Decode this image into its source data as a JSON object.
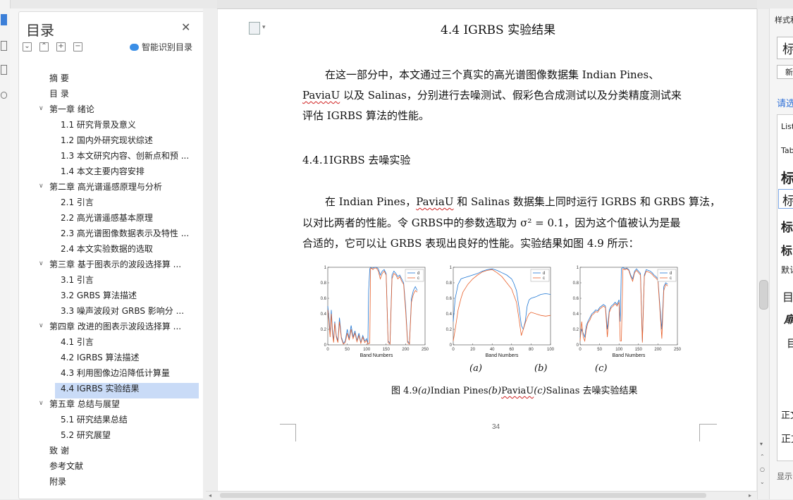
{
  "toc": {
    "title": "目录",
    "smart_label": "智能识别目录",
    "items": [
      {
        "label": "摘 要",
        "level": 0
      },
      {
        "label": "目 录",
        "level": 0
      },
      {
        "label": "第一章 绪论",
        "level": 0,
        "expanded": true
      },
      {
        "label": "1.1 研究背景及意义",
        "level": 1
      },
      {
        "label": "1.2 国内外研究现状综述",
        "level": 1
      },
      {
        "label": "1.3 本文研究内容、创新点和预 ...",
        "level": 1
      },
      {
        "label": "1.4 本文主要内容安排",
        "level": 1
      },
      {
        "label": "第二章 高光谱遥感原理与分析",
        "level": 0,
        "expanded": true
      },
      {
        "label": "2.1 引言",
        "level": 1
      },
      {
        "label": "2.2 高光谱遥感基本原理",
        "level": 1
      },
      {
        "label": "2.3 高光谱图像数据表示及特性 ...",
        "level": 1
      },
      {
        "label": "2.4 本文实验数据的选取",
        "level": 1
      },
      {
        "label": "第三章 基于图表示的波段选择算 ...",
        "level": 0,
        "expanded": true
      },
      {
        "label": "3.1 引言",
        "level": 1
      },
      {
        "label": "3.2 GRBS 算法描述",
        "level": 1
      },
      {
        "label": "3.3 噪声波段对 GRBS 影响分 ...",
        "level": 1
      },
      {
        "label": "第四章 改进的图表示波段选择算 ...",
        "level": 0,
        "expanded": true
      },
      {
        "label": "4.1 引言",
        "level": 1
      },
      {
        "label": "4.2 IGRBS 算法描述",
        "level": 1
      },
      {
        "label": "4.3 利用图像边沿降低计算量",
        "level": 1
      },
      {
        "label": "4.4 IGRBS 实验结果",
        "level": 1,
        "selected": true
      },
      {
        "label": "第五章 总结与展望",
        "level": 0,
        "expanded": true
      },
      {
        "label": "5.1 研究结果总结",
        "level": 1
      },
      {
        "label": "5.2 研究展望",
        "level": 1
      },
      {
        "label": "致 谢",
        "level": 0
      },
      {
        "label": "参考文献",
        "level": 0
      },
      {
        "label": "附录",
        "level": 0
      }
    ]
  },
  "doc": {
    "heading": "4.4 IGRBS 实验结果",
    "p1_l1": "在这一部分中，本文通过三个真实的高光谱图像数据集 Indian Pines、",
    "p1_l2a": "PaviaU",
    "p1_l2b": " 以及 Salinas，分别进行去噪测试、假彩色合成测试以及分类精度测试来",
    "p1_l3": "评估 IGRBS 算法的性能。",
    "subheading": "4.4.1IGRBS 去噪实验",
    "p2_l1a": "在 Indian Pines，",
    "p2_l1b": "PaviaU",
    "p2_l1c": " 和 Salinas 数据集上同时运行 IGRBS 和 GRBS 算法，",
    "p2_l2": "以对比两者的性能。令 GRBS中的参数选取为 σ² = 0.1，因为这个值被认为是最",
    "p2_l3": "合适的，它可以让 GRBS 表现出良好的性能。实验结果如图 4.9 所示：",
    "panel_a": "(a)",
    "panel_b": "(b)",
    "panel_c": "(c)",
    "caption_a": "图 4.9",
    "caption_b": "(a)",
    "caption_c": "Indian Pines",
    "caption_d": "(b)",
    "caption_e": "PaviaU",
    "caption_f": "(c)",
    "caption_g": "Salinas 去噪实验结果",
    "page_number": "34"
  },
  "right_pane": {
    "items": [
      "样式和",
      "标",
      "新",
      "请选",
      "List",
      "Tab",
      "标",
      "标",
      "标",
      "标",
      "默认",
      "目",
      "扉",
      "目",
      "正文",
      "正文",
      "显示"
    ]
  },
  "chart_data": [
    {
      "type": "line",
      "xlabel": "Band Numbers",
      "xlim": [
        0,
        250
      ],
      "ylim": [
        0,
        1
      ],
      "xticks": [
        0,
        50,
        100,
        150,
        200,
        250
      ],
      "yticks": [
        0,
        0.2,
        0.4,
        0.6,
        0.8,
        1
      ],
      "legend": "top-right",
      "series": [
        {
          "name": "d",
          "color": "#1f77d4",
          "x": [
            0,
            3,
            6,
            9,
            12,
            15,
            18,
            22,
            26,
            30,
            35,
            40,
            45,
            50,
            55,
            60,
            65,
            70,
            75,
            80,
            85,
            90,
            95,
            100,
            103,
            105,
            108,
            110,
            112,
            116,
            120,
            125,
            130,
            135,
            140,
            145,
            150,
            155,
            160,
            165,
            170,
            175,
            180,
            185,
            190,
            195,
            200,
            205,
            210,
            215,
            220,
            225,
            230
          ],
          "y": [
            0.5,
            0.35,
            0.15,
            0.45,
            0.2,
            0.05,
            0.3,
            0.12,
            0.05,
            0.35,
            0.1,
            0.02,
            0.05,
            0.2,
            0.08,
            0.25,
            0.1,
            0.18,
            0.05,
            0.15,
            0.03,
            0.12,
            0.05,
            0.08,
            0.02,
            0.7,
            0.98,
            1,
            0.99,
            0.99,
            1,
            1,
            0.98,
            0.9,
            0.95,
            0.97,
            0.92,
            0.05,
            0.02,
            0.9,
            0.95,
            0.92,
            0.88,
            0.9,
            0.85,
            0.8,
            0.5,
            0.05,
            0.02,
            0.6,
            0.7,
            0.75,
            0.7
          ]
        },
        {
          "name": "c",
          "color": "#e8612c",
          "x": [
            0,
            3,
            6,
            9,
            12,
            15,
            18,
            22,
            26,
            30,
            35,
            40,
            45,
            50,
            55,
            60,
            65,
            70,
            75,
            80,
            85,
            90,
            95,
            100,
            103,
            105,
            108,
            110,
            112,
            116,
            120,
            125,
            130,
            135,
            140,
            145,
            150,
            155,
            160,
            165,
            170,
            175,
            180,
            185,
            190,
            195,
            200,
            205,
            210,
            215,
            220,
            225,
            230
          ],
          "y": [
            0.45,
            0.3,
            0.1,
            0.4,
            0.15,
            0.03,
            0.28,
            0.1,
            0.03,
            0.3,
            0.08,
            0.01,
            0.03,
            0.15,
            0.06,
            0.2,
            0.08,
            0.15,
            0.04,
            0.12,
            0.02,
            0.1,
            0.03,
            0.06,
            0.01,
            0.02,
            0.02,
            0.98,
            0.99,
            0.97,
            0.99,
            0.99,
            0.95,
            0.85,
            0.92,
            0.95,
            0.9,
            0.03,
            0.01,
            0.85,
            0.92,
            0.9,
            0.85,
            0.88,
            0.82,
            0.78,
            0.45,
            0.03,
            0.01,
            0.55,
            0.65,
            0.7,
            0.68
          ]
        }
      ]
    },
    {
      "type": "line",
      "xlabel": "Band Numbers",
      "xlim": [
        0,
        100
      ],
      "ylim": [
        0,
        1
      ],
      "xticks": [
        0,
        20,
        40,
        60,
        80,
        100
      ],
      "yticks": [
        0,
        0.2,
        0.4,
        0.6,
        0.8,
        1
      ],
      "legend": "top-right",
      "series": [
        {
          "name": "d",
          "color": "#1f77d4",
          "x": [
            0,
            2,
            5,
            8,
            10,
            15,
            20,
            25,
            30,
            35,
            40,
            45,
            50,
            55,
            60,
            62,
            65,
            68,
            70,
            72,
            74,
            76,
            78,
            80,
            85,
            90,
            95,
            100
          ],
          "y": [
            0.3,
            0.6,
            0.78,
            0.85,
            0.86,
            0.88,
            0.9,
            0.92,
            0.95,
            0.97,
            0.98,
            0.96,
            0.93,
            0.9,
            0.85,
            0.8,
            0.7,
            0.45,
            0.25,
            0.2,
            0.3,
            0.5,
            0.58,
            0.6,
            0.62,
            0.65,
            0.66,
            0.65
          ]
        },
        {
          "name": "c",
          "color": "#e8612c",
          "x": [
            0,
            2,
            5,
            8,
            10,
            15,
            20,
            25,
            30,
            35,
            40,
            45,
            50,
            55,
            60,
            62,
            65,
            68,
            70,
            72,
            74,
            76,
            78,
            80,
            85,
            90,
            95,
            100
          ],
          "y": [
            0.05,
            0.2,
            0.45,
            0.6,
            0.68,
            0.78,
            0.85,
            0.9,
            0.94,
            0.96,
            0.97,
            0.93,
            0.88,
            0.8,
            0.72,
            0.65,
            0.55,
            0.3,
            0.12,
            0.2,
            0.28,
            0.35,
            0.4,
            0.42,
            0.4,
            0.38,
            0.37,
            0.38
          ]
        }
      ]
    },
    {
      "type": "line",
      "xlabel": "Band Numbers",
      "xlim": [
        0,
        250
      ],
      "ylim": [
        0,
        1
      ],
      "xticks": [
        0,
        50,
        100,
        150,
        200,
        250
      ],
      "yticks": [
        0,
        0.2,
        0.4,
        0.6,
        0.8,
        1
      ],
      "legend": "top-right",
      "series": [
        {
          "name": "d",
          "color": "#1f77d4",
          "x": [
            0,
            4,
            8,
            12,
            16,
            20,
            25,
            30,
            35,
            40,
            45,
            50,
            55,
            60,
            65,
            70,
            75,
            80,
            85,
            90,
            95,
            100,
            103,
            106,
            110,
            115,
            120,
            125,
            130,
            135,
            140,
            145,
            150,
            155,
            160,
            165,
            170,
            175,
            180,
            185,
            190,
            195,
            200,
            205,
            210,
            215,
            220,
            225
          ],
          "y": [
            0.1,
            0.2,
            0.15,
            0.1,
            0.25,
            0.3,
            0.35,
            0.4,
            0.42,
            0.45,
            0.44,
            0.48,
            0.5,
            0.52,
            0.5,
            0.2,
            0.45,
            0.5,
            0.52,
            0.55,
            0.52,
            0.58,
            0.3,
            0.98,
            1,
            0.98,
            0.99,
            0.97,
            0.9,
            0.85,
            0.95,
            0.98,
            0.95,
            0.92,
            0.05,
            0.9,
            0.97,
            0.96,
            0.95,
            0.93,
            0.9,
            0.88,
            0.85,
            0.5,
            0.2,
            0.75,
            0.8,
            0.78
          ]
        },
        {
          "name": "c",
          "color": "#e8612c",
          "x": [
            0,
            4,
            8,
            12,
            16,
            20,
            25,
            30,
            35,
            40,
            45,
            50,
            55,
            60,
            65,
            70,
            75,
            80,
            85,
            90,
            95,
            100,
            103,
            106,
            110,
            115,
            120,
            125,
            130,
            135,
            140,
            145,
            150,
            155,
            160,
            165,
            170,
            175,
            180,
            185,
            190,
            195,
            200,
            205,
            210,
            215,
            220,
            225
          ],
          "y": [
            0.05,
            0.3,
            0.1,
            0.05,
            0.2,
            0.28,
            0.32,
            0.38,
            0.4,
            0.43,
            0.42,
            0.46,
            0.48,
            0.5,
            0.48,
            0.1,
            0.42,
            0.48,
            0.5,
            0.53,
            0.5,
            0.55,
            0.05,
            0.05,
            0.98,
            0.97,
            0.98,
            0.96,
            0.88,
            0.82,
            0.93,
            0.96,
            0.93,
            0.9,
            0.03,
            0.88,
            0.95,
            0.94,
            0.93,
            0.91,
            0.88,
            0.86,
            0.83,
            0.45,
            0.08,
            0.7,
            0.78,
            0.76
          ]
        }
      ]
    }
  ]
}
